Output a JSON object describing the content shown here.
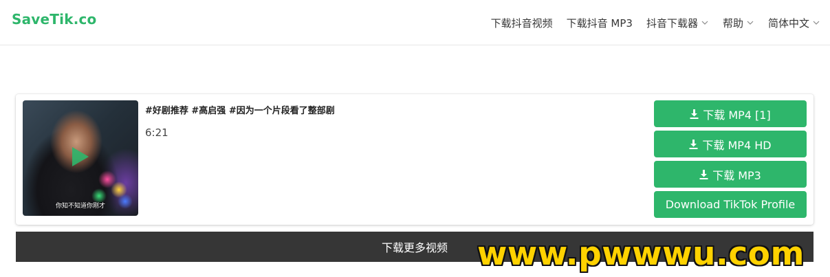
{
  "brand": {
    "logo_text": "SaveTik.co",
    "color": "#2eb66b"
  },
  "nav": {
    "items": [
      {
        "label": "下载抖音视频",
        "dropdown": false
      },
      {
        "label": "下载抖音 MP3",
        "dropdown": false
      },
      {
        "label": "抖音下载器",
        "dropdown": true
      },
      {
        "label": "帮助",
        "dropdown": true
      },
      {
        "label": "简体中文",
        "dropdown": true
      }
    ]
  },
  "video": {
    "title": "#好剧推荐 #高启强 #因为一个片段看了整部剧",
    "duration": "6:21",
    "thumbnail_caption": "你知不知道你刚才",
    "play_icon": "play-icon"
  },
  "buttons": {
    "mp4": "下载 MP4 [1]",
    "mp4_hd": "下载 MP4 HD",
    "mp3": "下载 MP3",
    "profile": "Download TikTok Profile",
    "icon": "download-icon",
    "color": "#2eb66b"
  },
  "more_videos_label": "下载更多视频",
  "watermark": "www.pwwwu.com"
}
